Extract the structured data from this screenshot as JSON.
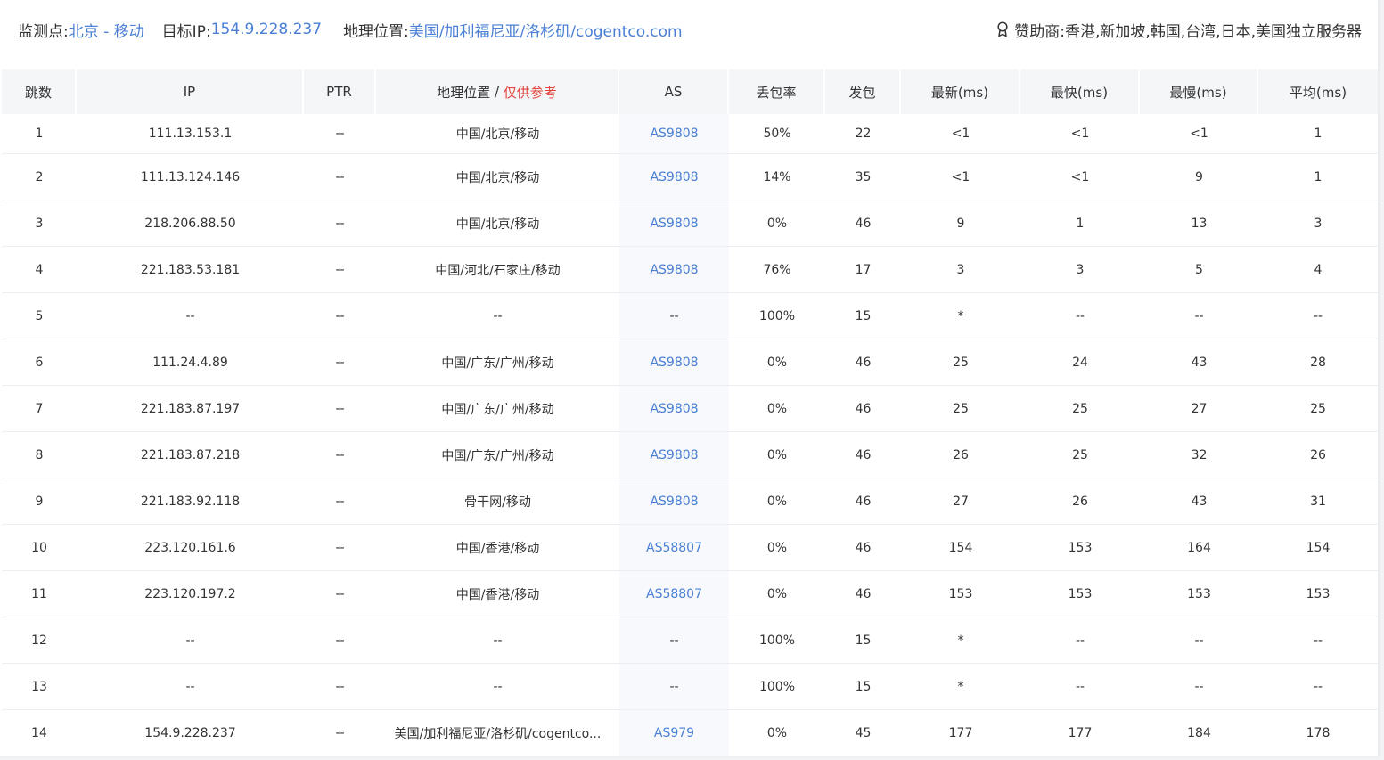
{
  "header": {
    "probe_label": "监测点:",
    "probe_value": "北京 - 移动",
    "target_label": "目标IP:",
    "target_value": "154.9.228.237",
    "geo_label": "地理位置:",
    "geo_value": "美国/加利福尼亚/洛杉矶/cogentco.com",
    "sponsor_icon": "award-icon",
    "sponsor_label": "赞助商:",
    "sponsor_value": "香港,新加坡,韩国,台湾,日本,美国独立服务器"
  },
  "colors": {
    "link": "#4a7fd4",
    "note": "#e0443c",
    "header_bg": "#f5f6f8"
  },
  "table": {
    "columns": {
      "hop": "跳数",
      "ip": "IP",
      "ptr": "PTR",
      "geo": "地理位置",
      "geo_sep": " / ",
      "geo_note": "仅供参考",
      "as": "AS",
      "loss": "丢包率",
      "sent": "发包",
      "last": "最新(ms)",
      "best": "最快(ms)",
      "worst": "最慢(ms)",
      "avg": "平均(ms)"
    },
    "rows": [
      {
        "hop": "1",
        "ip": "111.13.153.1",
        "ptr": "--",
        "geo": "中国/北京/移动",
        "as": "AS9808",
        "loss": "50%",
        "sent": "22",
        "last": "<1",
        "best": "<1",
        "worst": "<1",
        "avg": "1"
      },
      {
        "hop": "2",
        "ip": "111.13.124.146",
        "ptr": "--",
        "geo": "中国/北京/移动",
        "as": "AS9808",
        "loss": "14%",
        "sent": "35",
        "last": "<1",
        "best": "<1",
        "worst": "9",
        "avg": "1"
      },
      {
        "hop": "3",
        "ip": "218.206.88.50",
        "ptr": "--",
        "geo": "中国/北京/移动",
        "as": "AS9808",
        "loss": "0%",
        "sent": "46",
        "last": "9",
        "best": "1",
        "worst": "13",
        "avg": "3"
      },
      {
        "hop": "4",
        "ip": "221.183.53.181",
        "ptr": "--",
        "geo": "中国/河北/石家庄/移动",
        "as": "AS9808",
        "loss": "76%",
        "sent": "17",
        "last": "3",
        "best": "3",
        "worst": "5",
        "avg": "4"
      },
      {
        "hop": "5",
        "ip": "--",
        "ptr": "--",
        "geo": "--",
        "as": "--",
        "loss": "100%",
        "sent": "15",
        "last": "*",
        "best": "--",
        "worst": "--",
        "avg": "--"
      },
      {
        "hop": "6",
        "ip": "111.24.4.89",
        "ptr": "--",
        "geo": "中国/广东/广州/移动",
        "as": "AS9808",
        "loss": "0%",
        "sent": "46",
        "last": "25",
        "best": "24",
        "worst": "43",
        "avg": "28"
      },
      {
        "hop": "7",
        "ip": "221.183.87.197",
        "ptr": "--",
        "geo": "中国/广东/广州/移动",
        "as": "AS9808",
        "loss": "0%",
        "sent": "46",
        "last": "25",
        "best": "25",
        "worst": "27",
        "avg": "25"
      },
      {
        "hop": "8",
        "ip": "221.183.87.218",
        "ptr": "--",
        "geo": "中国/广东/广州/移动",
        "as": "AS9808",
        "loss": "0%",
        "sent": "46",
        "last": "26",
        "best": "25",
        "worst": "32",
        "avg": "26"
      },
      {
        "hop": "9",
        "ip": "221.183.92.118",
        "ptr": "--",
        "geo": "骨干网/移动",
        "as": "AS9808",
        "loss": "0%",
        "sent": "46",
        "last": "27",
        "best": "26",
        "worst": "43",
        "avg": "31"
      },
      {
        "hop": "10",
        "ip": "223.120.161.6",
        "ptr": "--",
        "geo": "中国/香港/移动",
        "as": "AS58807",
        "loss": "0%",
        "sent": "46",
        "last": "154",
        "best": "153",
        "worst": "164",
        "avg": "154"
      },
      {
        "hop": "11",
        "ip": "223.120.197.2",
        "ptr": "--",
        "geo": "中国/香港/移动",
        "as": "AS58807",
        "loss": "0%",
        "sent": "46",
        "last": "153",
        "best": "153",
        "worst": "153",
        "avg": "153"
      },
      {
        "hop": "12",
        "ip": "--",
        "ptr": "--",
        "geo": "--",
        "as": "--",
        "loss": "100%",
        "sent": "15",
        "last": "*",
        "best": "--",
        "worst": "--",
        "avg": "--"
      },
      {
        "hop": "13",
        "ip": "--",
        "ptr": "--",
        "geo": "--",
        "as": "--",
        "loss": "100%",
        "sent": "15",
        "last": "*",
        "best": "--",
        "worst": "--",
        "avg": "--"
      },
      {
        "hop": "14",
        "ip": "154.9.228.237",
        "ptr": "--",
        "geo": "美国/加利福尼亚/洛杉矶/cogentco...",
        "as": "AS979",
        "loss": "0%",
        "sent": "45",
        "last": "177",
        "best": "177",
        "worst": "184",
        "avg": "178"
      }
    ]
  }
}
